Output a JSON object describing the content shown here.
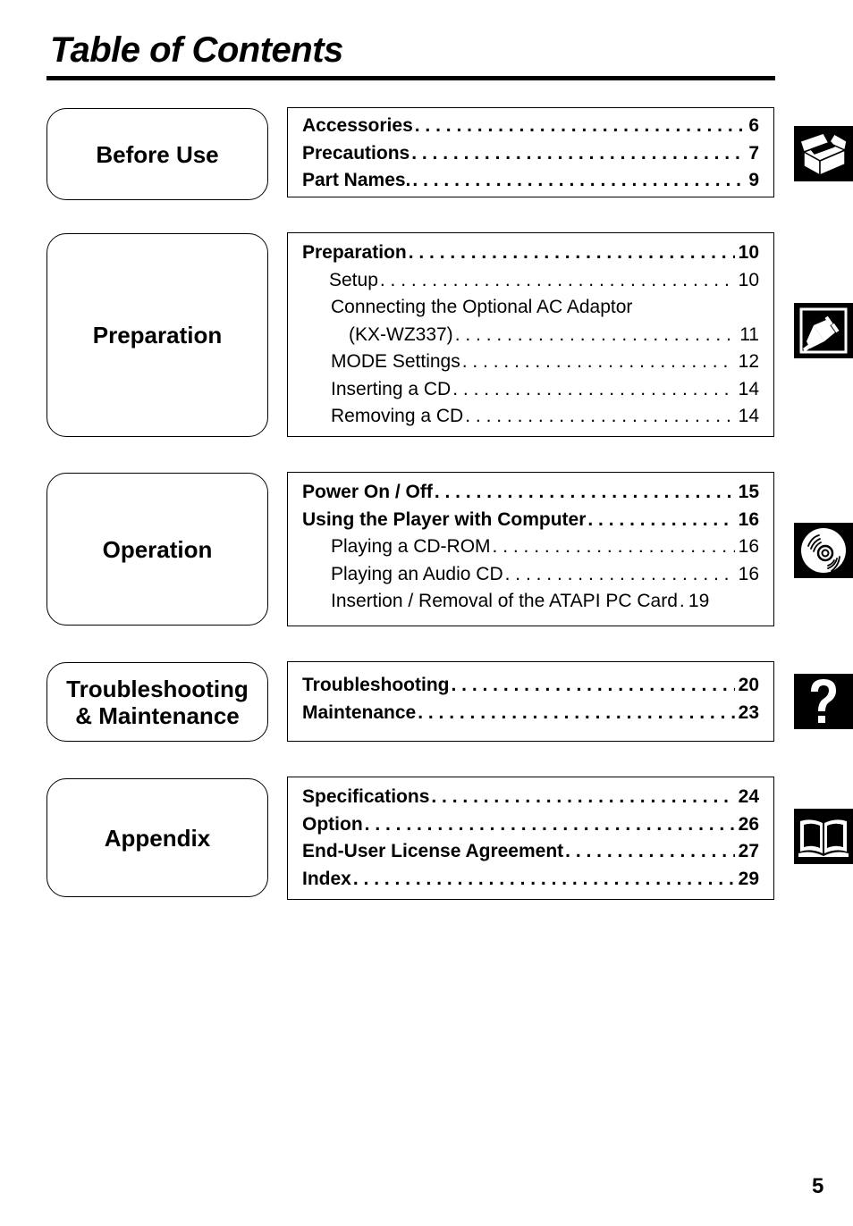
{
  "page": {
    "title": "Table of Contents",
    "page_number": "5"
  },
  "sections": [
    {
      "label": "Before Use",
      "icon": "open-box-icon",
      "entries": [
        {
          "text": "Accessories",
          "page": "6",
          "style": "bold"
        },
        {
          "text": "Precautions",
          "page": "7",
          "style": "bold"
        },
        {
          "text": "Part Names.",
          "page": "9",
          "style": "bold"
        }
      ]
    },
    {
      "label": "Preparation",
      "icon": "power-plug-icon",
      "entries": [
        {
          "text": "Preparation",
          "page": "10",
          "style": "bold"
        },
        {
          "text": "Setup",
          "page": "10",
          "style": "sub"
        },
        {
          "text": "Connecting the Optional AC Adaptor",
          "page": "",
          "style": "sub"
        },
        {
          "text": "(KX-WZ337)",
          "page": "11",
          "style": "sub2"
        },
        {
          "text": "MODE Settings",
          "page": "12",
          "style": "sub"
        },
        {
          "text": "Inserting a CD",
          "page": "14",
          "style": "sub"
        },
        {
          "text": "Removing a CD",
          "page": "14",
          "style": "sub"
        }
      ]
    },
    {
      "label": "Operation",
      "icon": "compact-disc-icon",
      "entries": [
        {
          "text": "Power On / Off",
          "page": "15",
          "style": "bold"
        },
        {
          "text": "Using the Player with Computer",
          "page": "16",
          "style": "bold"
        },
        {
          "text": "Playing a CD-ROM",
          "page": "16",
          "style": "sub"
        },
        {
          "text": "Playing an Audio CD",
          "page": "16",
          "style": "sub"
        },
        {
          "text": "Insertion / Removal of the ATAPI PC Card",
          "page": "19",
          "style": "sub"
        }
      ]
    },
    {
      "label_line1": "Troubleshooting",
      "label_line2": "& Maintenance",
      "icon": "question-mark-icon",
      "entries": [
        {
          "text": "Troubleshooting",
          "page": "20",
          "style": "bold"
        },
        {
          "text": "Maintenance",
          "page": "23",
          "style": "bold"
        }
      ]
    },
    {
      "label": "Appendix",
      "icon": "open-book-icon",
      "entries": [
        {
          "text": "Specifications",
          "page": "24",
          "style": "bold"
        },
        {
          "text": "Option",
          "page": "26",
          "style": "bold"
        },
        {
          "text": "End-User License Agreement",
          "page": "27",
          "style": "bold"
        },
        {
          "text": "Index",
          "page": "29",
          "style": "bold"
        }
      ]
    }
  ]
}
